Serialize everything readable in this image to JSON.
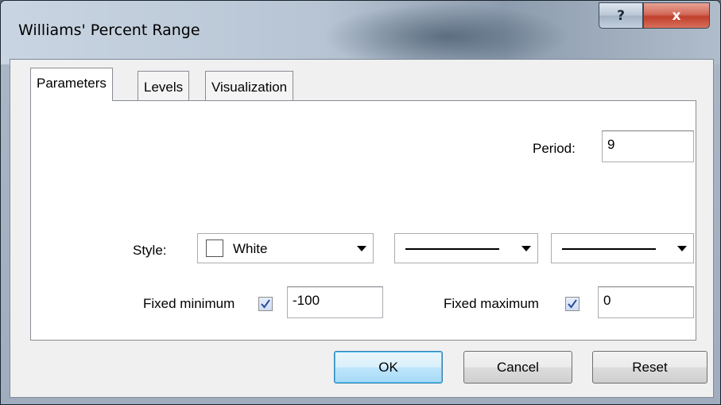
{
  "window": {
    "title": "Williams' Percent Range",
    "help_label": "?",
    "close_label": "x"
  },
  "tabs": [
    {
      "label": "Parameters",
      "active": true
    },
    {
      "label": "Levels",
      "active": false
    },
    {
      "label": "Visualization",
      "active": false
    }
  ],
  "parameters": {
    "period_label": "Period:",
    "period_value": "9",
    "style_label": "Style:",
    "color_name": "White",
    "color_value": "#ffffff",
    "line_style": "solid",
    "line_width": "thin",
    "fixed_min_label": "Fixed minimum",
    "fixed_min_checked": true,
    "fixed_min_value": "-100",
    "fixed_max_label": "Fixed maximum",
    "fixed_max_checked": true,
    "fixed_max_value": "0"
  },
  "buttons": {
    "ok": "OK",
    "cancel": "Cancel",
    "reset": "Reset"
  },
  "icons": {
    "dropdown": "chevron-down-icon",
    "check": "checkmark-icon",
    "check_color": "#2b4c9a"
  }
}
